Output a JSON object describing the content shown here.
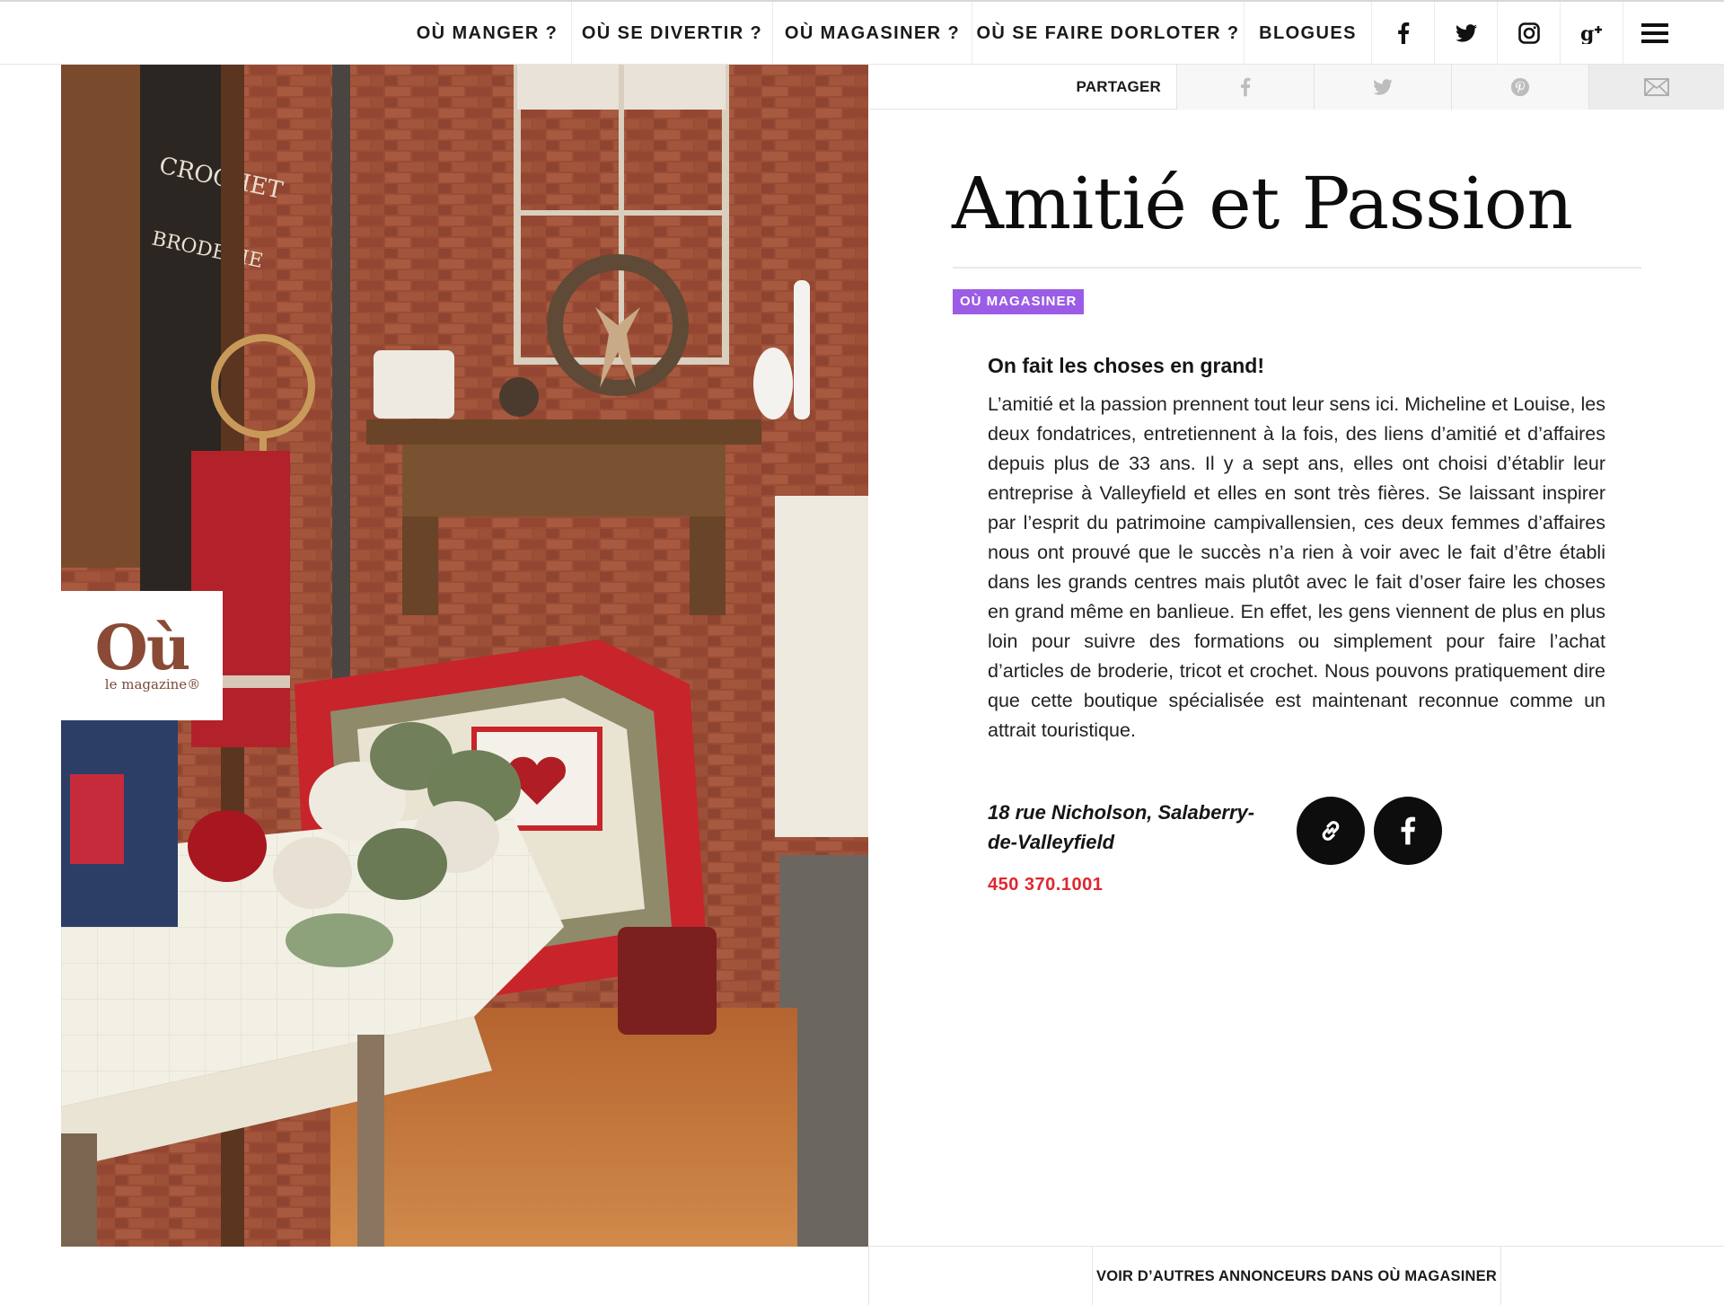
{
  "nav": {
    "items": [
      {
        "label": "OÙ MANGER ?"
      },
      {
        "label": "OÙ SE DIVERTIR ?"
      },
      {
        "label": "OÙ MAGASINER ?"
      },
      {
        "label": "OÙ SE FAIRE DORLOTER ?"
      },
      {
        "label": "BLOGUES"
      }
    ],
    "icons": [
      "facebook-icon",
      "twitter-icon",
      "instagram-icon",
      "google-plus-icon",
      "menu-icon"
    ]
  },
  "share": {
    "label": "PARTAGER",
    "buttons": [
      "facebook-icon",
      "twitter-icon",
      "pinterest-icon",
      "email-icon"
    ]
  },
  "logo": {
    "word": "Où",
    "sub": "le magazine®"
  },
  "article": {
    "title": "Amitié et Passion",
    "category": "OÙ MAGASINER",
    "subhead": "On fait les choses en grand!",
    "body": "L’amitié et la passion prennent tout leur sens ici. Micheline et Louise, les deux fondatrices, entretiennent à la fois, des liens d’amitié et d’affaires depuis plus de 33 ans. Il y a sept ans, elles ont choisi d’établir leur entreprise à Valleyfield et elles en sont très fières. Se laissant inspirer par l’esprit du patrimoine campivallensien, ces deux femmes d’affaires nous ont prouvé que le succès n’a rien à voir avec le fait d’être établi dans les grands centres mais plutôt avec le fait d’oser faire les choses en grand même en banlieue. En effet, les gens viennent de plus en plus loin pour suivre des formations ou simplement pour faire l’achat d’articles de broderie, tricot et crochet. Nous pouvons pratiquement dire que cette boutique spécialisée est maintenant reconnue comme un attrait touristique.",
    "address": "18 rue Nicholson, Salaberry-de-Valleyfield",
    "phone": "450 370.1001"
  },
  "footer": {
    "more_link": "VOIR D’AUTRES ANNONCEURS DANS OÙ MAGASINER"
  },
  "colors": {
    "category_badge": "#9b5de5",
    "phone": "#e0262f",
    "text": "#1a1a1a"
  }
}
